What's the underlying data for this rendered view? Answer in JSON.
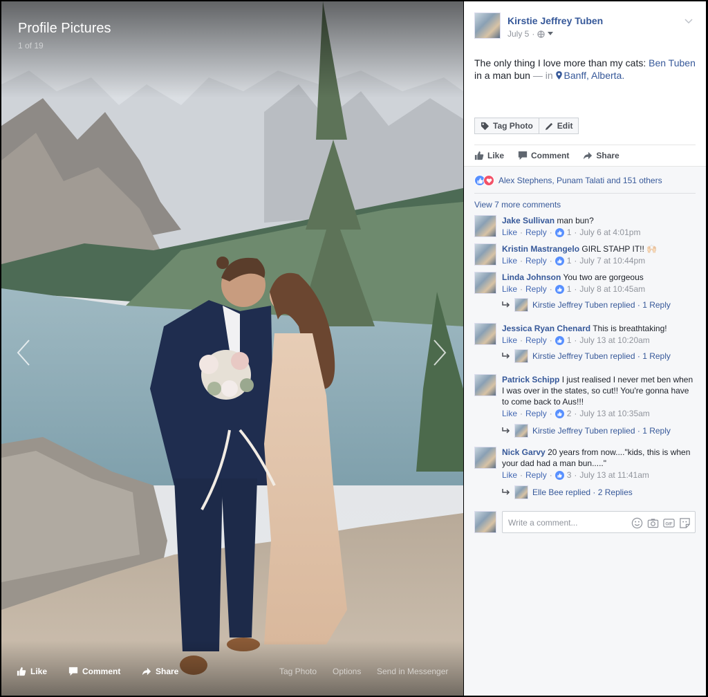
{
  "theater": {
    "album_title": "Profile Pictures",
    "photo_count": "1 of 19",
    "actions": {
      "like": "Like",
      "comment": "Comment",
      "share": "Share",
      "tag_photo": "Tag Photo",
      "options": "Options",
      "send_in_messenger": "Send in Messenger"
    }
  },
  "post": {
    "author": "Kirstie Jeffrey Tuben",
    "date": "July 5",
    "text_before": "The only thing I love more than my cats: ",
    "tagged_person": "Ben Tuben",
    "text_after": " in a man bun",
    "dash_in": " — in ",
    "location": "Banff, Alberta.",
    "tag_photo_label": "Tag Photo",
    "edit_label": "Edit",
    "like_label": "Like",
    "comment_label": "Comment",
    "share_label": "Share"
  },
  "feedback": {
    "reactions_text": "Alex Stephens, Punam Talati and 151 others",
    "view_more": "View 7 more comments",
    "like_action": "Like",
    "reply_action": "Reply",
    "comments": [
      {
        "name": "Jake Sullivan",
        "text": "man bun?",
        "likes": "1",
        "time": "July 6 at 4:01pm"
      },
      {
        "name": "Kristin Mastrangelo",
        "text": "GIRL STAHP IT!! 🙌🏻",
        "likes": "1",
        "time": "July 7 at 10:44pm"
      },
      {
        "name": "Linda Johnson",
        "text": "You two are gorgeous",
        "likes": "1",
        "time": "July 8 at 10:45am",
        "reply": "Kirstie Jeffrey Tuben replied · 1 Reply"
      },
      {
        "name": "Jessica Ryan Chenard",
        "text": "This is breathtaking!",
        "likes": "1",
        "time": "July 13 at 10:20am",
        "reply": "Kirstie Jeffrey Tuben replied · 1 Reply"
      },
      {
        "name": "Patrick Schipp",
        "text": "I just realised I never met ben when I was over in the states, so cut!! You're gonna have to come back to Aus!!!",
        "likes": "2",
        "time": "July 13 at 10:35am",
        "reply": "Kirstie Jeffrey Tuben replied · 1 Reply"
      },
      {
        "name": "Nick Garvy",
        "text": "20 years from now....\"kids, this is when your dad had a man bun.....\"",
        "likes": "3",
        "time": "July 13 at 11:41am",
        "reply": "Elle Bee replied · 2 Replies"
      }
    ],
    "composer_placeholder": "Write a comment..."
  },
  "colors": {
    "link": "#365899",
    "like_blue": "#5890ff",
    "love_red": "#f25268",
    "panel_bg": "#f6f7f9"
  }
}
